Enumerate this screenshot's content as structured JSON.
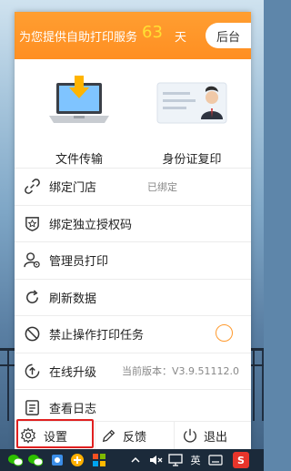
{
  "header": {
    "message": "为您提供自助打印服务",
    "days": "63",
    "unit": "天",
    "admin_button": "后台"
  },
  "features": [
    {
      "label": "文件传输",
      "icon": "laptop-download-icon"
    },
    {
      "label": "身份证复印",
      "icon": "id-card-icon"
    }
  ],
  "menu": [
    {
      "label": "绑定门店",
      "value": "已绑定",
      "icon": "link-icon"
    },
    {
      "label": "绑定独立授权码",
      "icon": "star-shield-icon"
    },
    {
      "label": "管理员打印",
      "icon": "admin-user-icon"
    },
    {
      "label": "刷新数据",
      "icon": "refresh-icon"
    },
    {
      "label": "禁止操作打印任务",
      "icon": "ban-icon",
      "toggle": false
    },
    {
      "label": "在线升级",
      "value": "当前版本：V3.9.51112.0",
      "icon": "upgrade-icon"
    },
    {
      "label": "查看日志",
      "icon": "log-icon"
    }
  ],
  "footer": [
    {
      "label": "设置",
      "icon": "gear-icon"
    },
    {
      "label": "反馈",
      "icon": "pencil-icon"
    },
    {
      "label": "退出",
      "icon": "power-icon"
    }
  ],
  "taskbar": {
    "lang": "英",
    "tray": [
      "wechat-icon",
      "wechat-icon",
      "network-icon",
      "plus-icon",
      "windows-icon",
      "chevron-icon",
      "mute-icon",
      "monitor-icon",
      "keyboard-icon",
      "sogou-icon"
    ]
  },
  "colors": {
    "accent": "#ff9a2e",
    "days_color": "#ffe033",
    "highlight": "#e02020"
  }
}
